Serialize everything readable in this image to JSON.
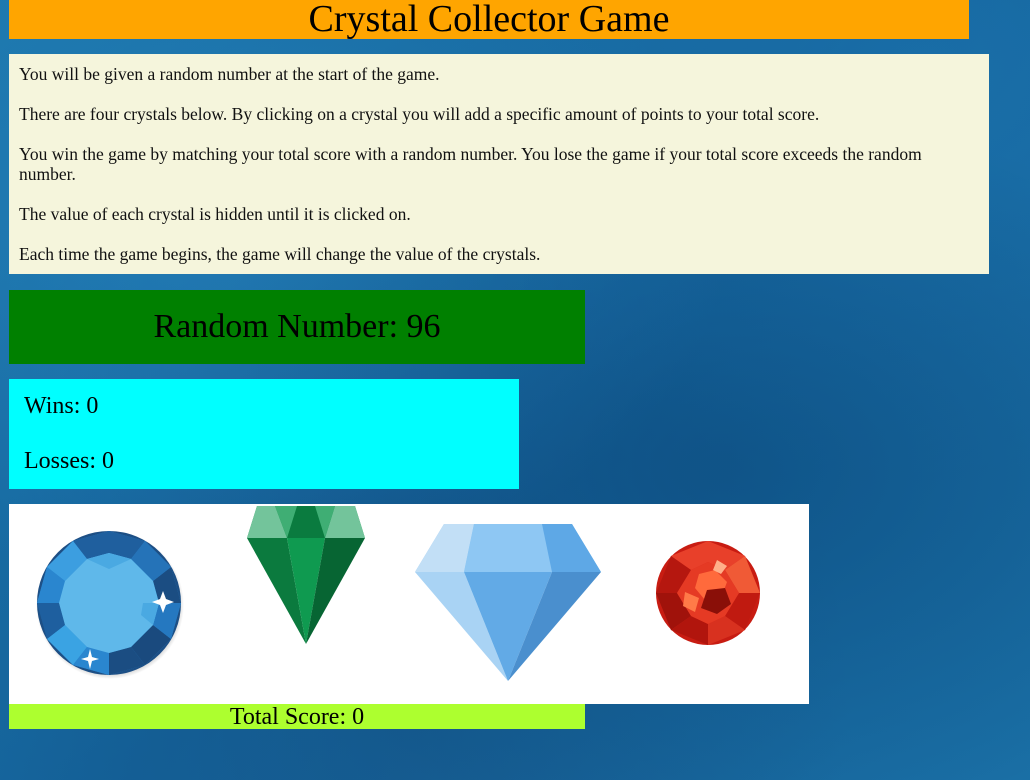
{
  "header": {
    "title": "Crystal Collector Game"
  },
  "instructions": [
    "You will be given a random number at the start of the game.",
    "There are four crystals below. By clicking on a crystal you will add a specific amount of points to your total score.",
    "You win the game by matching your total score with a random number. You lose the game if your total score exceeds the random number.",
    "The value of each crystal is hidden until it is clicked on.",
    "Each time the game begins, the game will change the value of the crystals."
  ],
  "random_number": {
    "label": "Random Number: 96",
    "value": 96
  },
  "stats": {
    "wins_label": "Wins: 0",
    "wins": 0,
    "losses_label": "Losses: 0",
    "losses": 0
  },
  "crystals": [
    {
      "icon": "blue-round-gem-icon",
      "color": "#2a7fc4"
    },
    {
      "icon": "green-emerald-icon",
      "color": "#0a8a4a"
    },
    {
      "icon": "light-blue-diamond-icon",
      "color": "#7ab8ec"
    },
    {
      "icon": "red-ruby-icon",
      "color": "#d7261b"
    }
  ],
  "total_score": {
    "label": "Total Score: 0",
    "value": 0
  },
  "colors": {
    "title_bg": "#ffa500",
    "instructions_bg": "#f5f5dc",
    "random_bg": "#008000",
    "stats_bg": "#00ffff",
    "crystal_panel_bg": "#ffffff",
    "score_bg": "#adff2f"
  }
}
